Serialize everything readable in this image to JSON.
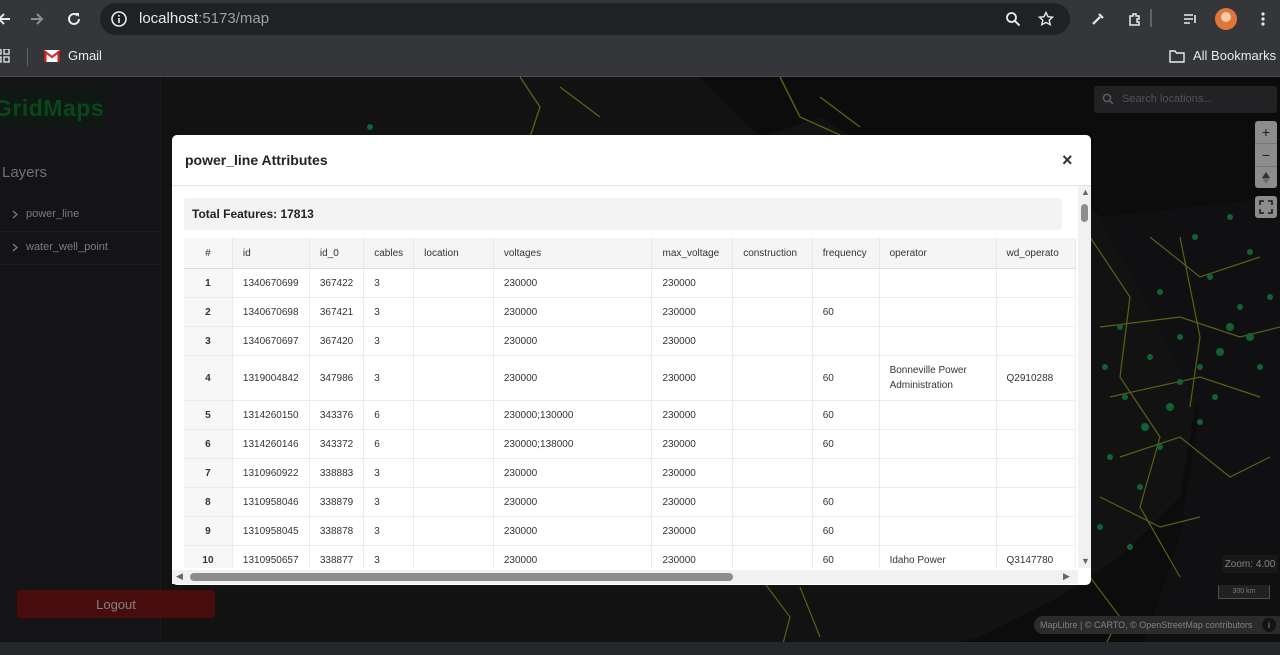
{
  "browser": {
    "url_host": "localhost",
    "url_path": ":5173/map",
    "bookmarks": {
      "gmail": "Gmail",
      "all": "All Bookmarks"
    }
  },
  "app": {
    "brand": "GridMaps",
    "layers_title": "Layers",
    "layers": [
      {
        "label": "power_line"
      },
      {
        "label": "water_well_point"
      }
    ],
    "logout_label": "Logout",
    "search_placeholder": "Search locations...",
    "zoom_readout": "Zoom: 4.00",
    "scale_label": "300 km",
    "attribution": "MapLibre | © CARTO, © OpenStreetMap contributors",
    "colors": {
      "brand": "#0f7a2f",
      "logout": "#7a1616",
      "lines": "#8fae1b",
      "points": "#1fa85a"
    }
  },
  "modal": {
    "title": "power_line Attributes",
    "close": "×",
    "total": "Total Features: 17813",
    "columns": [
      "#",
      "id",
      "id_0",
      "cables",
      "location",
      "voltages",
      "max_voltage",
      "construction",
      "frequency",
      "operator",
      "wd_operato"
    ],
    "rows": [
      [
        "1",
        "1340670699",
        "367422",
        "3",
        "",
        "230000",
        "230000",
        "",
        "",
        "",
        ""
      ],
      [
        "2",
        "1340670698",
        "367421",
        "3",
        "",
        "230000",
        "230000",
        "",
        "60",
        "",
        ""
      ],
      [
        "3",
        "1340670697",
        "367420",
        "3",
        "",
        "230000",
        "230000",
        "",
        "",
        "",
        ""
      ],
      [
        "4",
        "1319004842",
        "347986",
        "3",
        "",
        "230000",
        "230000",
        "",
        "60",
        "Bonneville Power Administration",
        "Q2910288"
      ],
      [
        "5",
        "1314260150",
        "343376",
        "6",
        "",
        "230000;130000",
        "230000",
        "",
        "60",
        "",
        ""
      ],
      [
        "6",
        "1314260146",
        "343372",
        "6",
        "",
        "230000;138000",
        "230000",
        "",
        "60",
        "",
        ""
      ],
      [
        "7",
        "1310960922",
        "338883",
        "3",
        "",
        "230000",
        "230000",
        "",
        "",
        "",
        ""
      ],
      [
        "8",
        "1310958046",
        "338879",
        "3",
        "",
        "230000",
        "230000",
        "",
        "60",
        "",
        ""
      ],
      [
        "9",
        "1310958045",
        "338878",
        "3",
        "",
        "230000",
        "230000",
        "",
        "60",
        "",
        ""
      ],
      [
        "10",
        "1310950657",
        "338877",
        "3",
        "",
        "230000",
        "230000",
        "",
        "60",
        "Idaho Power",
        "Q3147780"
      ]
    ]
  }
}
